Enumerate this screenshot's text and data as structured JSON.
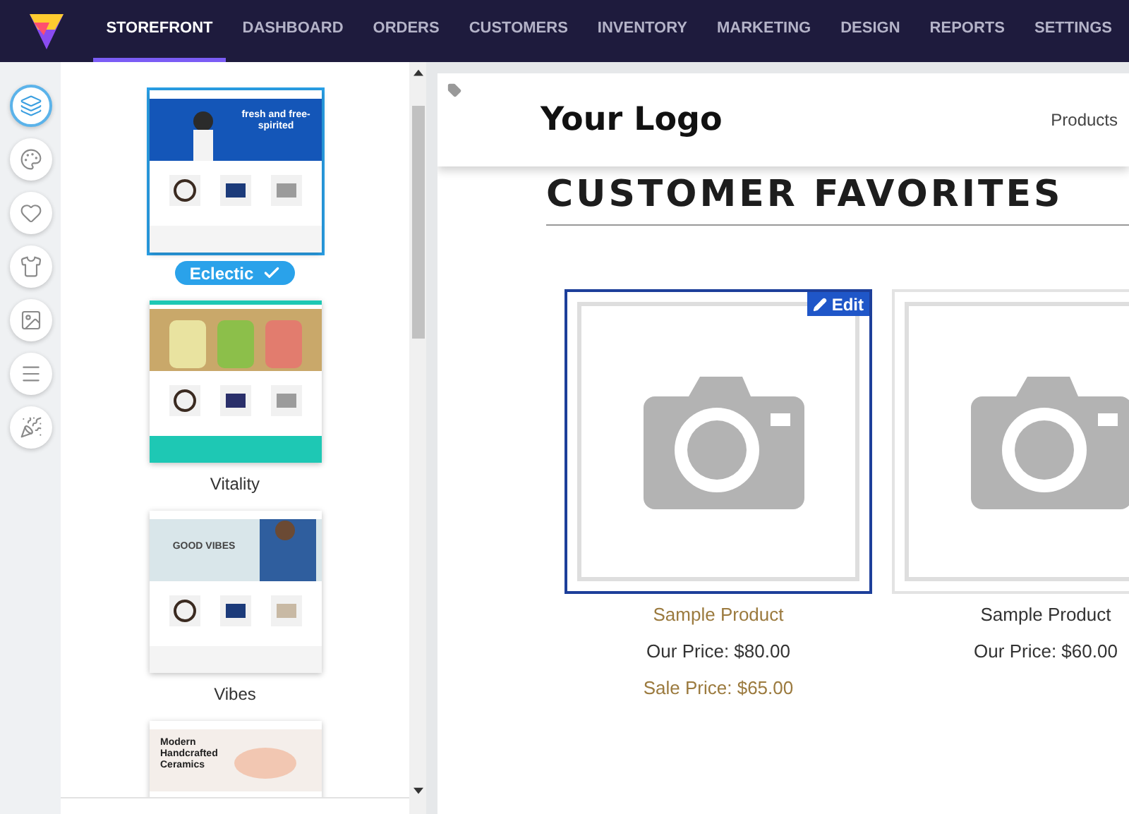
{
  "nav": {
    "tabs": [
      {
        "label": "STOREFRONT",
        "selected": true
      },
      {
        "label": "DASHBOARD",
        "selected": false
      },
      {
        "label": "ORDERS",
        "selected": false
      },
      {
        "label": "CUSTOMERS",
        "selected": false
      },
      {
        "label": "INVENTORY",
        "selected": false
      },
      {
        "label": "MARKETING",
        "selected": false
      },
      {
        "label": "DESIGN",
        "selected": false
      },
      {
        "label": "REPORTS",
        "selected": false
      },
      {
        "label": "SETTINGS",
        "selected": false
      }
    ]
  },
  "rail": {
    "items": [
      {
        "selected": true
      },
      {
        "selected": false
      },
      {
        "selected": false
      },
      {
        "selected": false
      },
      {
        "selected": false
      },
      {
        "selected": false
      },
      {
        "selected": false
      }
    ]
  },
  "templates": [
    {
      "name": "Eclectic",
      "selected": true,
      "heading": "fresh and free-spirited"
    },
    {
      "name": "Vitality",
      "selected": false
    },
    {
      "name": "Vibes",
      "selected": false,
      "heading": "GOOD VIBES"
    },
    {
      "selected": false,
      "heading": "Modern Handcrafted Ceramics"
    }
  ],
  "preview": {
    "logo": "Your Logo",
    "nav_link": "Products",
    "section_title": "CUSTOMER FAVORITES",
    "products": [
      {
        "name": "Sample Product",
        "our_price": "Our Price: $80.00",
        "sale_price": "Sale Price: $65.00",
        "selected": true,
        "edit_label": "Edit"
      },
      {
        "name": "Sample Product",
        "our_price": "Our Price: $60.00",
        "selected": false
      }
    ]
  }
}
